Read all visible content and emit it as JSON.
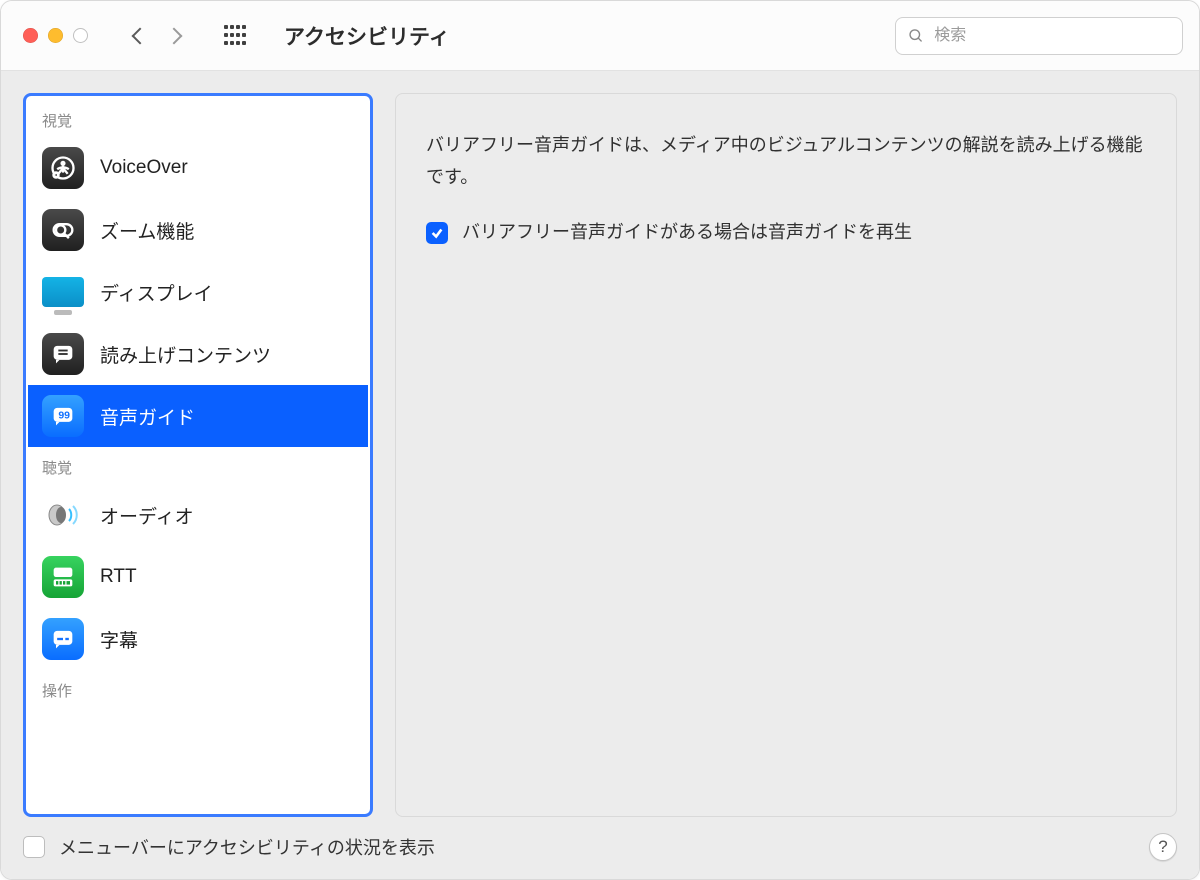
{
  "window": {
    "title": "アクセシビリティ"
  },
  "search": {
    "placeholder": "検索",
    "value": ""
  },
  "sidebar": {
    "groups": [
      {
        "label": "視覚",
        "items": [
          {
            "id": "voiceover",
            "label": "VoiceOver",
            "icon": "voiceover-icon",
            "selected": false
          },
          {
            "id": "zoom",
            "label": "ズーム機能",
            "icon": "zoom-icon",
            "selected": false
          },
          {
            "id": "display",
            "label": "ディスプレイ",
            "icon": "display-icon",
            "selected": false
          },
          {
            "id": "spoken",
            "label": "読み上げコンテンツ",
            "icon": "spoken-icon",
            "selected": false
          },
          {
            "id": "audioguide",
            "label": "音声ガイド",
            "icon": "audioguide-icon",
            "selected": true
          }
        ]
      },
      {
        "label": "聴覚",
        "items": [
          {
            "id": "audio",
            "label": "オーディオ",
            "icon": "audio-icon",
            "selected": false
          },
          {
            "id": "rtt",
            "label": "RTT",
            "icon": "rtt-icon",
            "selected": false
          },
          {
            "id": "captions",
            "label": "字幕",
            "icon": "captions-icon",
            "selected": false
          }
        ]
      },
      {
        "label": "操作",
        "items": []
      }
    ]
  },
  "panel": {
    "description": "バリアフリー音声ガイドは、メディア中のビジュアルコンテンツの解説を読み上げる機能です。",
    "checkbox_label": "バリアフリー音声ガイドがある場合は音声ガイドを再生",
    "checkbox_checked": true
  },
  "footer": {
    "menubar_label": "メニューバーにアクセシビリティの状況を表示",
    "menubar_checked": false,
    "help": "?"
  },
  "colors": {
    "accent": "#0a60ff"
  }
}
